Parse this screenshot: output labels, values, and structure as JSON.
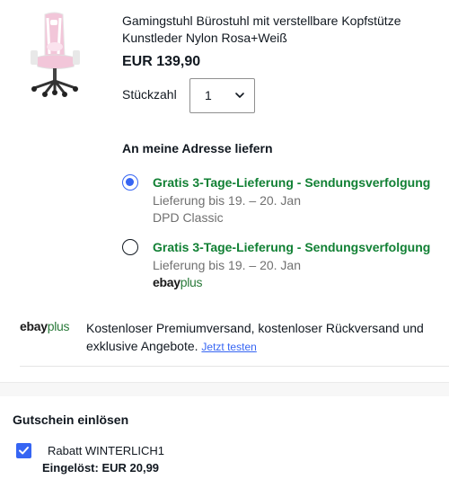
{
  "product": {
    "image_alt": "chair-thumbnail",
    "title": "Gamingstuhl Bürostuhl mit verstellbare Kopfstütze Kunstleder Nylon Rosa+Weiß",
    "price": "EUR 139,90"
  },
  "quantity": {
    "label": "Stückzahl",
    "value": "1",
    "icon": "chevron-down-icon"
  },
  "delivery": {
    "heading": "An meine Adresse liefern",
    "options": [
      {
        "title": "Gratis 3-Tage-Lieferung - Sendungsverfolgung",
        "date": "Lieferung bis 19. – 20. Jan",
        "carrier": "DPD Classic",
        "selected": true
      },
      {
        "title": "Gratis 3-Tage-Lieferung - Sendungsverfolgung",
        "date": "Lieferung bis 19. – 20. Jan",
        "logo_ebay": "ebay",
        "logo_plus": "plus",
        "selected": false
      }
    ]
  },
  "ebay_plus": {
    "logo_ebay": "ebay",
    "logo_plus": "plus",
    "text": "Kostenloser Premiumversand, kostenloser Rückversand und exklusive Angebote. ",
    "link": "Jetzt testen"
  },
  "coupon": {
    "heading": "Gutschein einlösen",
    "name": "Rabatt WINTERLICH1",
    "redeemed": "Eingelöst: EUR 20,99",
    "checked": true
  },
  "colors": {
    "accent": "#3665f3",
    "shipping_green": "#118034",
    "muted_text": "#707070",
    "plus_green": "#2a7a3a"
  }
}
